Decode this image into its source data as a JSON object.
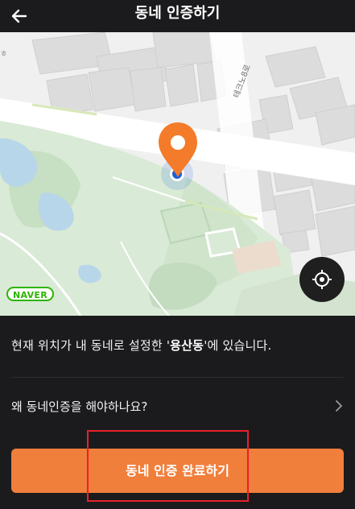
{
  "header": {
    "title": "동네 인증하기",
    "back_icon": "arrow-left-icon"
  },
  "map": {
    "road_label": "테크노8로",
    "edge_text": "ㅎ",
    "logo_text": "NAVER",
    "marker_color": "#f47b2a",
    "current_location_color": "#1a5fd8",
    "locate_icon": "crosshair-icon"
  },
  "content": {
    "location_message_prefix": "현재 위치가 내 동네로 설정한 '",
    "location_name": "용산동",
    "location_message_suffix": "'에 있습니다.",
    "faq_label": "왜 동네인증을 해야하나요?",
    "faq_icon": "chevron-right-icon"
  },
  "cta": {
    "label": "동네 인증 완료하기",
    "color": "#f07f3c"
  },
  "annotation": {
    "highlight_color": "#e8212a"
  }
}
